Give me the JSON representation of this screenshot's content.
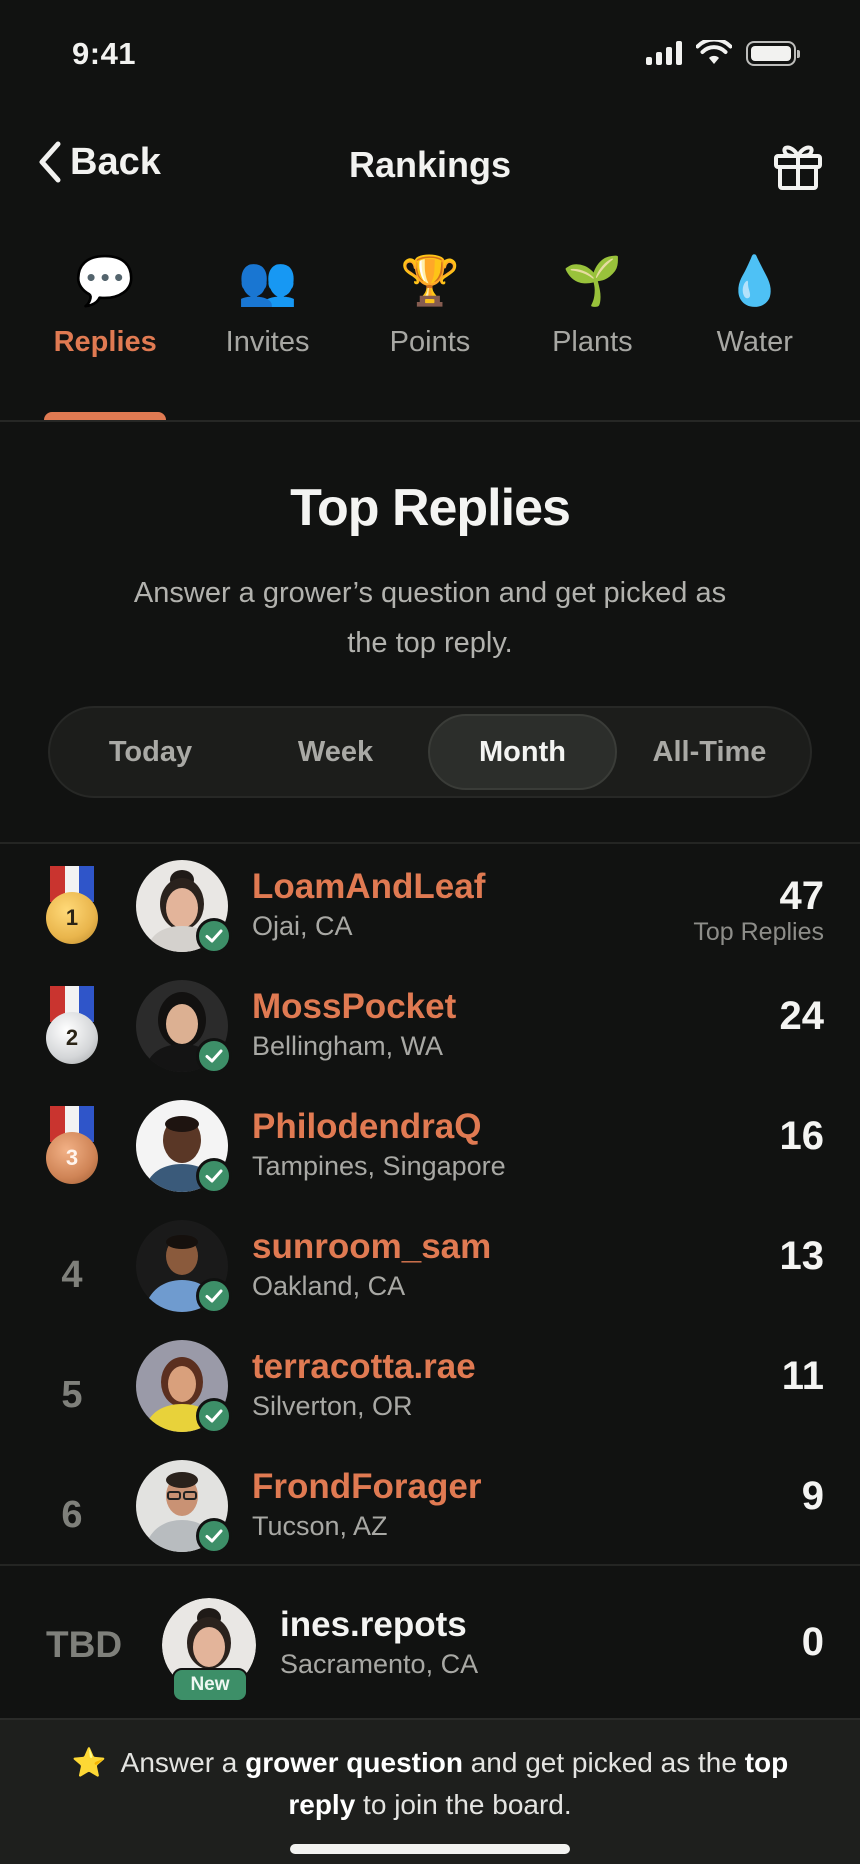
{
  "status": {
    "time": "9:41"
  },
  "nav": {
    "back_label": "Back",
    "title": "Rankings"
  },
  "tabs": [
    {
      "label": "Replies",
      "emoji": "💬",
      "active": true
    },
    {
      "label": "Invites",
      "emoji": "👥",
      "active": false
    },
    {
      "label": "Points",
      "emoji": "🏆",
      "active": false
    },
    {
      "label": "Plants",
      "emoji": "🌱",
      "active": false
    },
    {
      "label": "Water",
      "emoji": "💧",
      "active": false
    }
  ],
  "header": {
    "title": "Top Replies",
    "subtitle": "Answer a grower’s question and get picked as the top reply."
  },
  "periods": {
    "options": [
      "Today",
      "Week",
      "Month",
      "All-Time"
    ],
    "selected": "Month"
  },
  "leaders": [
    {
      "rank": "1",
      "name": "LoamAndLeaf",
      "location": "Ojai, CA",
      "score": "47",
      "score_caption": "Top Replies",
      "medal": "gold"
    },
    {
      "rank": "2",
      "name": "MossPocket",
      "location": "Bellingham, WA",
      "score": "24",
      "medal": "silver"
    },
    {
      "rank": "3",
      "name": "PhilodendraQ",
      "location": "Tampines, Singapore",
      "score": "16",
      "medal": "bronze"
    },
    {
      "rank": "4",
      "name": "sunroom_sam",
      "location": "Oakland, CA",
      "score": "13"
    },
    {
      "rank": "5",
      "name": "terracotta.rae",
      "location": "Silverton, OR",
      "score": "11"
    },
    {
      "rank": "6",
      "name": "FrondForager",
      "location": "Tucson, AZ",
      "score": "9"
    }
  ],
  "current_user": {
    "rank": "TBD",
    "name": "ines.repots",
    "location": "Sacramento, CA",
    "score": "0",
    "badge": "New"
  },
  "footer": {
    "star": "⭐",
    "text_1": "Answer a ",
    "bold_1": "grower question",
    "text_2": " and get picked as the ",
    "bold_2": "top reply",
    "text_3": " to join the board."
  },
  "colors": {
    "accent": "#e07a52",
    "verified": "#3d8f68",
    "gold": "#e9b54c",
    "silver": "#d4d6d8",
    "bronze": "#cf8456"
  }
}
